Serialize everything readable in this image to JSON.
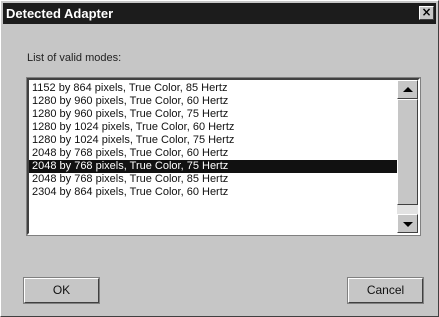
{
  "window": {
    "title": "Detected Adapter",
    "close_glyph": "×"
  },
  "list": {
    "label": "List of valid modes:",
    "items": [
      "1152 by 864 pixels, True Color, 85 Hertz",
      "1280 by 960 pixels, True Color, 60 Hertz",
      "1280 by 960 pixels, True Color, 75 Hertz",
      "1280 by 1024 pixels, True Color, 60 Hertz",
      "1280 by 1024 pixels, True Color, 75 Hertz",
      "2048 by 768 pixels, True Color, 60 Hertz",
      "2048 by 768 pixels, True Color, 75 Hertz",
      "2048 by 768 pixels, True Color, 85 Hertz",
      "2304 by 864 pixels, True Color, 60 Hertz"
    ],
    "selected_index": 6
  },
  "buttons": {
    "ok_label": "OK",
    "cancel_label": "Cancel"
  }
}
